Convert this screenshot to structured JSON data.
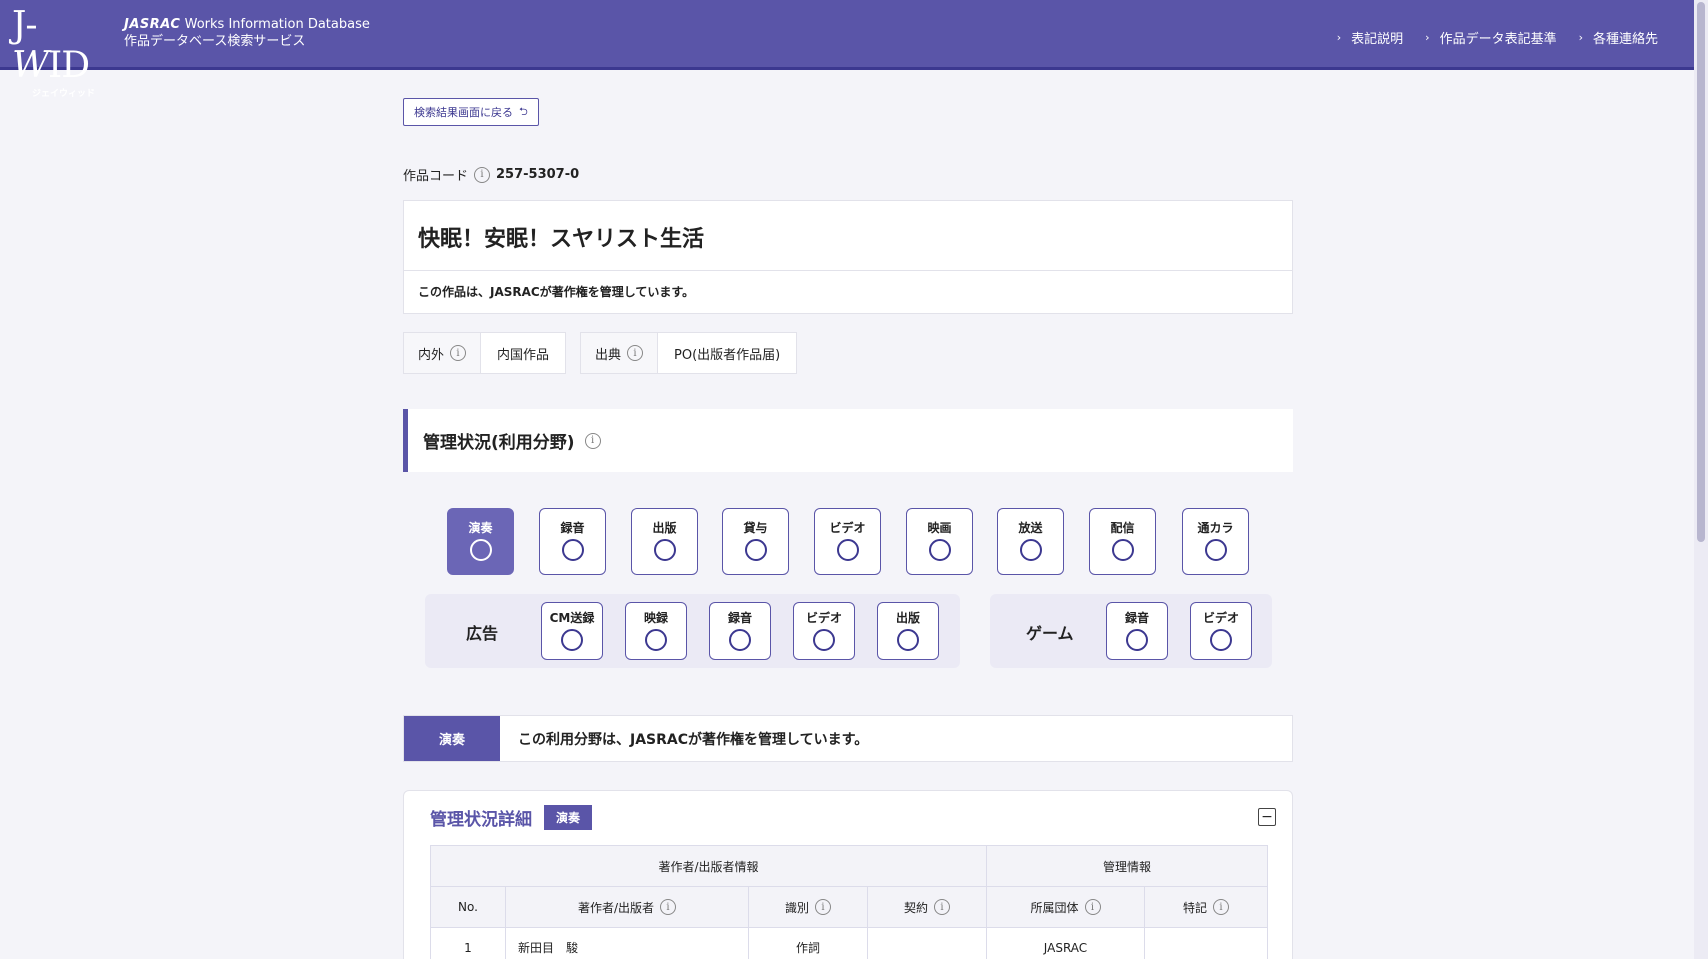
{
  "header": {
    "logo_main_j": "J-",
    "logo_main_w": "W",
    "logo_main_id": "ID",
    "logo_sub": "ジェイウィッド",
    "brand_name": "JASRAC",
    "brand_db": "Works Information Database",
    "brand_service": "作品データベース検索サービス",
    "nav": [
      "表記説明",
      "作品データ表記基準",
      "各種連絡先"
    ]
  },
  "back_button": "検索結果画面に戻る",
  "work": {
    "code_label": "作品コード",
    "code_value": "257-5307-0",
    "title": "快眠！安眠！スヤリスト生活",
    "notice": "この作品は、JASRACが著作権を管理しています。"
  },
  "meta": {
    "naigai_label": "内外",
    "naigai_value": "内国作品",
    "source_label": "出典",
    "source_value": "PO(出版者作品届)"
  },
  "management": {
    "heading": "管理状況(利用分野)",
    "fields": [
      "演奏",
      "録音",
      "出版",
      "貸与",
      "ビデオ",
      "映画",
      "放送",
      "配信",
      "通カラ"
    ],
    "ad_label": "広告",
    "ad_fields": [
      "CM送録",
      "映録",
      "録音",
      "ビデオ",
      "出版"
    ],
    "game_label": "ゲーム",
    "game_fields": [
      "録音",
      "ビデオ"
    ]
  },
  "status": {
    "tag": "演奏",
    "text": "この利用分野は、JASRACが著作権を管理しています。"
  },
  "detail": {
    "title": "管理状況詳細",
    "pill": "演奏",
    "group_author": "著作者/出版者情報",
    "group_mgmt": "管理情報",
    "col_no": "No.",
    "col_author": "著作者/出版者",
    "col_role": "識別",
    "col_contract": "契約",
    "col_org": "所属団体",
    "col_note": "特記",
    "rows": [
      {
        "no": "1",
        "author": "新田目　駿",
        "role": "作詞",
        "contract": "",
        "org": "JASRAC",
        "note": ""
      }
    ]
  }
}
